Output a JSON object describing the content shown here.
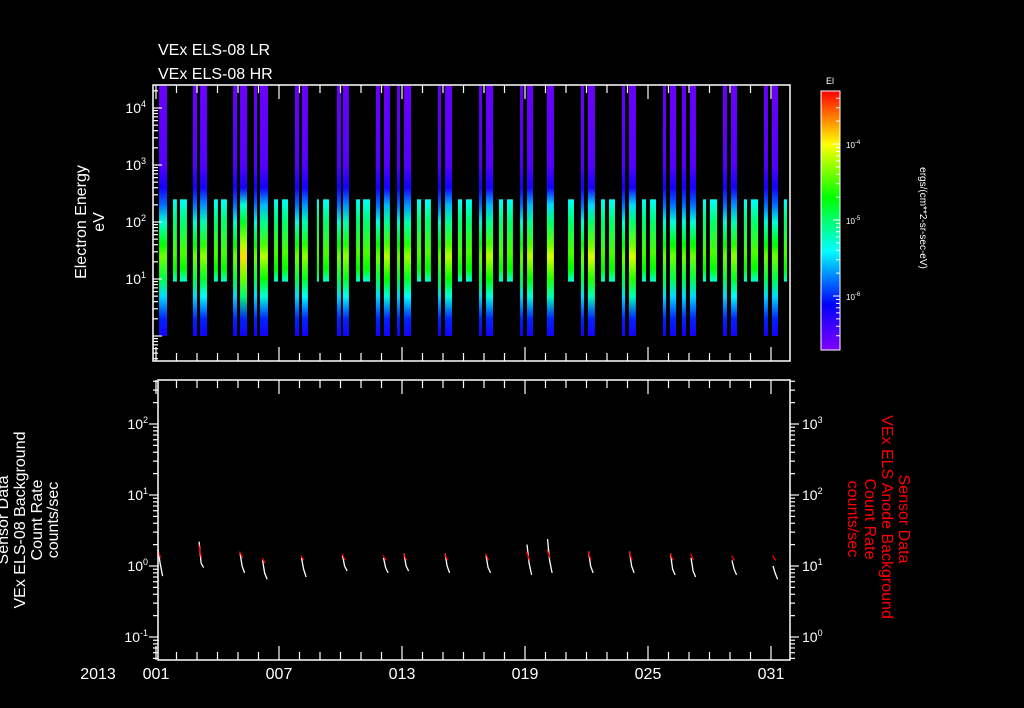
{
  "titles": [
    "VEx ELS-08 LR",
    "VEx ELS-08 HR"
  ],
  "year_label": "2013",
  "chart_data": [
    {
      "type": "heatmap",
      "title": "VEx ELS-08 LR / VEx ELS-08 HR",
      "ylabel": [
        "Electron Energy",
        "eV"
      ],
      "xlim_day_of_year": [
        1,
        32
      ],
      "x_ticks": [
        {
          "day": 1,
          "label": "001"
        },
        {
          "day": 7,
          "label": "007"
        },
        {
          "day": 13,
          "label": "013"
        },
        {
          "day": 19,
          "label": "019"
        },
        {
          "day": 25,
          "label": "025"
        },
        {
          "day": 31,
          "label": "031"
        }
      ],
      "ylim_eV": [
        0.36,
        24500
      ],
      "y_scale": "log",
      "y_ticks": [
        {
          "value": 10,
          "base": "10",
          "exp": "1"
        },
        {
          "value": 100,
          "base": "10",
          "exp": "2"
        },
        {
          "value": 1000,
          "base": "10",
          "exp": "3"
        },
        {
          "value": 10000,
          "base": "10",
          "exp": "4"
        }
      ],
      "colorbar": {
        "label": "El",
        "units": "ergs/(cm**2-sr-sec-eV)",
        "log_range": [
          -6.7,
          -3.3
        ],
        "ticks": [
          {
            "log": -4,
            "base": "10",
            "exp": "-4"
          },
          {
            "log": -5,
            "base": "10",
            "exp": "-5"
          },
          {
            "log": -6,
            "base": "10",
            "exp": "-6"
          }
        ],
        "stops": [
          {
            "log": -6.7,
            "color": "#8000ff"
          },
          {
            "log": -6.1,
            "color": "#0000ff"
          },
          {
            "log": -5.4,
            "color": "#00ffff"
          },
          {
            "log": -4.7,
            "color": "#00ff00"
          },
          {
            "log": -4.0,
            "color": "#ffff00"
          },
          {
            "log": -3.3,
            "color": "#ff0000"
          }
        ]
      },
      "hr_profile": {
        "energy_range_eV": [
          1,
          24500
        ],
        "energies_eV": [
          24500,
          1000,
          400,
          200,
          100,
          40,
          25,
          10,
          5,
          2,
          1
        ],
        "log_flux": [
          -6.6,
          -6.5,
          -6.2,
          -5.8,
          -5.3,
          -4.7,
          -4.4,
          -4.9,
          -5.5,
          -6.0,
          -6.2
        ]
      },
      "lr_profile": {
        "energy_range_eV": [
          9,
          250
        ],
        "energies_eV": [
          250,
          100,
          30,
          15,
          9
        ],
        "log_flux": [
          -5.4,
          -5.0,
          -4.5,
          -4.7,
          -5.3
        ]
      },
      "hr_intervals_day": [
        [
          1.15,
          1.54
        ],
        [
          2.8,
          3.0
        ],
        [
          3.15,
          3.49
        ],
        [
          4.76,
          4.95
        ],
        [
          5.1,
          5.44
        ],
        [
          5.78,
          5.93
        ],
        [
          6.07,
          6.46
        ],
        [
          7.78,
          7.98
        ],
        [
          8.12,
          8.41
        ],
        [
          9.83,
          10.02
        ],
        [
          10.12,
          10.41
        ],
        [
          11.73,
          11.93
        ],
        [
          12.12,
          12.41
        ],
        [
          12.76,
          12.9
        ],
        [
          13.1,
          13.44
        ],
        [
          14.76,
          14.9
        ],
        [
          15.1,
          15.44
        ],
        [
          16.76,
          16.9
        ],
        [
          17.1,
          17.44
        ],
        [
          18.76,
          18.9
        ],
        [
          19.1,
          19.39
        ],
        [
          20.07,
          20.41
        ],
        [
          21.73,
          21.88
        ],
        [
          22.07,
          22.41
        ],
        [
          23.73,
          23.88
        ],
        [
          24.07,
          24.41
        ],
        [
          25.73,
          25.88
        ],
        [
          26.07,
          26.37
        ],
        [
          26.66,
          26.85
        ],
        [
          27.05,
          27.34
        ],
        [
          28.66,
          28.85
        ],
        [
          29.05,
          29.34
        ],
        [
          30.66,
          30.85
        ],
        [
          31.05,
          31.34
        ]
      ],
      "hr_offsets": [
        0,
        0,
        0.1,
        0,
        0.5,
        0,
        0.2,
        0,
        0.1,
        0,
        0.1,
        0,
        0.2,
        0,
        0.1,
        0,
        0.2,
        0,
        0.2,
        0,
        0.2,
        0.3,
        0,
        0.3,
        0,
        0.3,
        0,
        0,
        0,
        0,
        0,
        0.1,
        0,
        0
      ],
      "lr_intervals_day": [
        [
          1.83,
          2.02
        ],
        [
          2.17,
          2.51
        ],
        [
          3.83,
          4.02
        ],
        [
          4.17,
          4.46
        ],
        [
          6.76,
          6.95
        ],
        [
          7.15,
          7.44
        ],
        [
          8.85,
          8.95
        ],
        [
          9.15,
          9.44
        ],
        [
          10.76,
          10.95
        ],
        [
          11.1,
          11.44
        ],
        [
          13.73,
          13.93
        ],
        [
          14.12,
          14.41
        ],
        [
          15.73,
          15.93
        ],
        [
          16.12,
          16.41
        ],
        [
          17.73,
          17.93
        ],
        [
          18.12,
          18.41
        ],
        [
          21.1,
          21.39
        ],
        [
          22.71,
          22.9
        ],
        [
          23.1,
          23.39
        ],
        [
          24.71,
          24.9
        ],
        [
          25.1,
          25.39
        ],
        [
          27.68,
          27.83
        ],
        [
          28.02,
          28.37
        ],
        [
          29.68,
          29.83
        ],
        [
          30.02,
          30.37
        ],
        [
          31.63,
          31.78
        ]
      ]
    },
    {
      "type": "line",
      "ylabel_left": [
        "Sensor Data",
        "VEx ELS-08 Background",
        "Count Rate",
        "counts/sec"
      ],
      "ylabel_right": [
        "Sensor Data",
        "VEx ELS Anode Background",
        "Count Rate",
        "counts/sec"
      ],
      "xlim_day_of_year": [
        1,
        32
      ],
      "ylim_left": [
        0.048,
        430
      ],
      "ylim_right": [
        0.48,
        4300
      ],
      "y_scale": "log",
      "y_ticks_left": [
        {
          "value": 0.1,
          "base": "10",
          "exp": "-1"
        },
        {
          "value": 1,
          "base": "10",
          "exp": "0"
        },
        {
          "value": 10,
          "base": "10",
          "exp": "1"
        },
        {
          "value": 100,
          "base": "10",
          "exp": "2"
        }
      ],
      "y_ticks_right": [
        {
          "value": 1,
          "base": "10",
          "exp": "0"
        },
        {
          "value": 10,
          "base": "10",
          "exp": "1"
        },
        {
          "value": 100,
          "base": "10",
          "exp": "2"
        },
        {
          "value": 1000,
          "base": "10",
          "exp": "3"
        }
      ],
      "series": [
        {
          "name": "VEx ELS-08 Background",
          "axis": "left",
          "color": "#ffffff",
          "orbits": [
            {
              "day": 1.2,
              "values": [
                1.7,
                1.1,
                0.72
              ]
            },
            {
              "day": 3.2,
              "values": [
                2.2,
                1.1,
                0.95
              ]
            },
            {
              "day": 5.2,
              "values": [
                1.5,
                1.0,
                0.8
              ]
            },
            {
              "day": 6.3,
              "values": [
                1.2,
                0.8,
                0.65
              ]
            },
            {
              "day": 8.2,
              "values": [
                1.3,
                0.9,
                0.7
              ]
            },
            {
              "day": 10.2,
              "values": [
                1.4,
                1.0,
                0.85
              ]
            },
            {
              "day": 12.2,
              "values": [
                1.3,
                0.95,
                0.8
              ]
            },
            {
              "day": 13.2,
              "values": [
                1.5,
                1.0,
                0.85
              ]
            },
            {
              "day": 15.2,
              "values": [
                1.5,
                1.0,
                0.8
              ]
            },
            {
              "day": 17.2,
              "values": [
                1.4,
                0.95,
                0.8
              ]
            },
            {
              "day": 19.2,
              "values": [
                2.0,
                1.1,
                0.75
              ]
            },
            {
              "day": 20.2,
              "values": [
                2.4,
                1.2,
                0.8
              ]
            },
            {
              "day": 22.2,
              "values": [
                1.6,
                1.0,
                0.8
              ]
            },
            {
              "day": 24.2,
              "values": [
                1.6,
                1.0,
                0.8
              ]
            },
            {
              "day": 26.2,
              "values": [
                1.5,
                0.9,
                0.75
              ]
            },
            {
              "day": 27.2,
              "values": [
                1.3,
                0.85,
                0.7
              ]
            },
            {
              "day": 29.2,
              "values": [
                1.2,
                0.9,
                0.75
              ]
            },
            {
              "day": 31.2,
              "values": [
                1.0,
                0.8,
                0.65
              ]
            }
          ]
        },
        {
          "name": "VEx ELS Anode Background",
          "axis": "right",
          "color": "#ff0000",
          "orbits": [
            {
              "day": 1.2,
              "values": [
                17,
                13
              ]
            },
            {
              "day": 3.2,
              "values": [
                20,
                13
              ]
            },
            {
              "day": 5.2,
              "values": [
                16,
                13
              ]
            },
            {
              "day": 6.3,
              "values": [
                13,
                11
              ]
            },
            {
              "day": 8.2,
              "values": [
                14,
                12
              ]
            },
            {
              "day": 10.2,
              "values": [
                15,
                12
              ]
            },
            {
              "day": 12.2,
              "values": [
                14,
                12
              ]
            },
            {
              "day": 13.2,
              "values": [
                15,
                12
              ]
            },
            {
              "day": 15.2,
              "values": [
                15,
                12
              ]
            },
            {
              "day": 17.2,
              "values": [
                15,
                12
              ]
            },
            {
              "day": 19.2,
              "values": [
                16,
                12
              ]
            },
            {
              "day": 20.2,
              "values": [
                17,
                13
              ]
            },
            {
              "day": 22.2,
              "values": [
                16,
                12
              ]
            },
            {
              "day": 24.2,
              "values": [
                16,
                12
              ]
            },
            {
              "day": 26.2,
              "values": [
                15,
                12
              ]
            },
            {
              "day": 27.2,
              "values": [
                15,
                12
              ]
            },
            {
              "day": 29.2,
              "values": [
                14,
                12
              ]
            },
            {
              "day": 31.2,
              "values": [
                14,
                12
              ]
            }
          ]
        }
      ]
    }
  ]
}
